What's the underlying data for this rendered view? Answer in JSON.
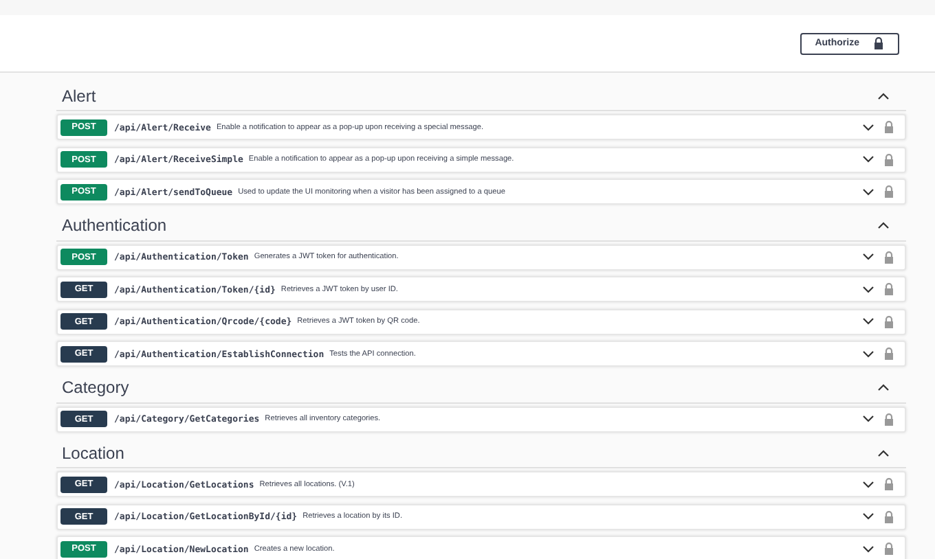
{
  "header": {
    "authorize_button": "Authorize"
  },
  "sections": [
    {
      "title": "Alert",
      "expanded": true,
      "operations": [
        {
          "method": "POST",
          "kind": "post",
          "path": "/api/Alert/Receive",
          "description": "Enable a notification to appear as a pop-up upon receiving a special message."
        },
        {
          "method": "POST",
          "kind": "post",
          "path": "/api/Alert/ReceiveSimple",
          "description": "Enable a notification to appear as a pop-up upon receiving a simple message."
        },
        {
          "method": "POST",
          "kind": "post",
          "path": "/api/Alert/sendToQueue",
          "description": "Used to update the UI monitoring when a visitor has been assigned to a queue"
        }
      ]
    },
    {
      "title": "Authentication",
      "expanded": true,
      "operations": [
        {
          "method": "POST",
          "kind": "post",
          "path": "/api/Authentication/Token",
          "description": "Generates a JWT token for authentication."
        },
        {
          "method": "GET",
          "kind": "get",
          "path": "/api/Authentication/Token/{id}",
          "description": "Retrieves a JWT token by user ID."
        },
        {
          "method": "GET",
          "kind": "get",
          "path": "/api/Authentication/Qrcode/{code}",
          "description": "Retrieves a JWT token by QR code."
        },
        {
          "method": "GET",
          "kind": "get",
          "path": "/api/Authentication/EstablishConnection",
          "description": "Tests the API connection."
        }
      ]
    },
    {
      "title": "Category",
      "expanded": true,
      "operations": [
        {
          "method": "GET",
          "kind": "get",
          "path": "/api/Category/GetCategories",
          "description": "Retrieves all inventory categories."
        }
      ]
    },
    {
      "title": "Location",
      "expanded": true,
      "operations": [
        {
          "method": "GET",
          "kind": "get",
          "path": "/api/Location/GetLocations",
          "description": "Retrieves all locations. (V.1)"
        },
        {
          "method": "GET",
          "kind": "get",
          "path": "/api/Location/GetLocationById/{id}",
          "description": "Retrieves a location by its ID."
        },
        {
          "method": "POST",
          "kind": "post",
          "path": "/api/Location/NewLocation",
          "description": "Creates a new location."
        }
      ]
    }
  ]
}
